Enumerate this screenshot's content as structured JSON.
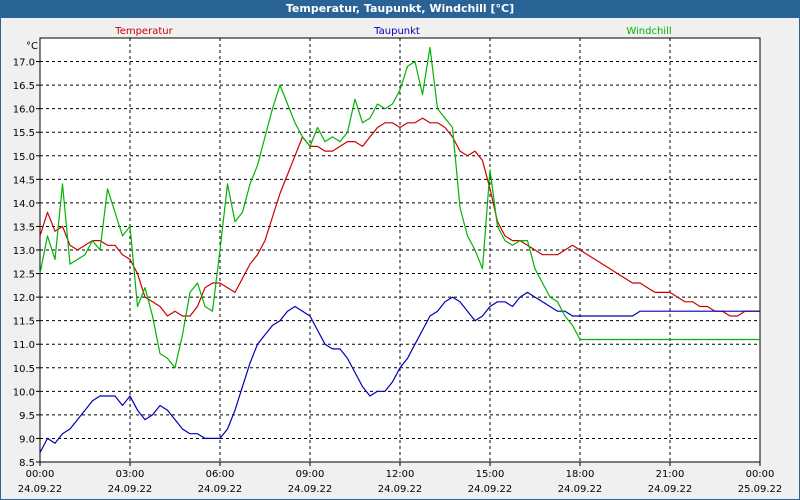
{
  "window": {
    "title": "Temperatur, Taupunkt, Windchill [°C]"
  },
  "chart_data": {
    "type": "line",
    "title": "Temperatur, Taupunkt, Windchill [°C]",
    "ylabel": "°C",
    "ylim": [
      8.5,
      17.5
    ],
    "yticks": [
      8.5,
      9.0,
      9.5,
      10.0,
      10.5,
      11.0,
      11.5,
      12.0,
      12.5,
      13.0,
      13.5,
      14.0,
      14.5,
      15.0,
      15.5,
      16.0,
      16.5,
      17.0
    ],
    "xlim": [
      "2022-09-24 00:00",
      "2022-09-25 00:00"
    ],
    "xticks": [
      {
        "time": "00:00",
        "date": "24.09.22"
      },
      {
        "time": "03:00",
        "date": "24.09.22"
      },
      {
        "time": "06:00",
        "date": "24.09.22"
      },
      {
        "time": "09:00",
        "date": "24.09.22"
      },
      {
        "time": "12:00",
        "date": "24.09.22"
      },
      {
        "time": "15:00",
        "date": "24.09.22"
      },
      {
        "time": "18:00",
        "date": "24.09.22"
      },
      {
        "time": "21:00",
        "date": "24.09.22"
      },
      {
        "time": "00:00",
        "date": "25.09.22"
      }
    ],
    "grid": true,
    "legend_position": "top",
    "x_hours": [
      0,
      0.25,
      0.5,
      0.75,
      1,
      1.25,
      1.5,
      1.75,
      2,
      2.25,
      2.5,
      2.75,
      3,
      3.25,
      3.5,
      3.75,
      4,
      4.25,
      4.5,
      4.75,
      5,
      5.25,
      5.5,
      5.75,
      6,
      6.25,
      6.5,
      6.75,
      7,
      7.25,
      7.5,
      7.75,
      8,
      8.25,
      8.5,
      8.75,
      9,
      9.25,
      9.5,
      9.75,
      10,
      10.25,
      10.5,
      10.75,
      11,
      11.25,
      11.5,
      11.75,
      12,
      12.25,
      12.5,
      12.75,
      13,
      13.25,
      13.5,
      13.75,
      14,
      14.25,
      14.5,
      14.75,
      15,
      15.25,
      15.5,
      15.75,
      16,
      16.25,
      16.5,
      16.75,
      17,
      17.25,
      17.5,
      17.75,
      18,
      18.25,
      18.5,
      18.75,
      19,
      19.25,
      19.5,
      19.75,
      20,
      20.25,
      20.5,
      20.75,
      21,
      21.25,
      21.5,
      21.75,
      22,
      22.25,
      22.5,
      22.75,
      23,
      23.25,
      23.5,
      23.75,
      24
    ],
    "series": [
      {
        "name": "Temperatur",
        "color": "#cc0000",
        "values": [
          13.3,
          13.8,
          13.4,
          13.5,
          13.1,
          13.0,
          13.1,
          13.2,
          13.2,
          13.1,
          13.1,
          12.9,
          12.8,
          12.5,
          12.0,
          11.9,
          11.8,
          11.6,
          11.7,
          11.6,
          11.6,
          11.8,
          12.2,
          12.3,
          12.3,
          12.2,
          12.1,
          12.4,
          12.7,
          12.9,
          13.2,
          13.7,
          14.2,
          14.6,
          15.0,
          15.4,
          15.2,
          15.2,
          15.1,
          15.1,
          15.2,
          15.3,
          15.3,
          15.2,
          15.4,
          15.6,
          15.7,
          15.7,
          15.6,
          15.7,
          15.7,
          15.8,
          15.7,
          15.7,
          15.6,
          15.4,
          15.1,
          15.0,
          15.1,
          14.9,
          14.3,
          13.6,
          13.3,
          13.2,
          13.2,
          13.1,
          13.0,
          12.9,
          12.9,
          12.9,
          13.0,
          13.1,
          13.0,
          12.9,
          12.8,
          12.7,
          12.6,
          12.5,
          12.4,
          12.3,
          12.3,
          12.2,
          12.1,
          12.1,
          12.1,
          12.0,
          11.9,
          11.9,
          11.8,
          11.8,
          11.7,
          11.7,
          11.6,
          11.6,
          11.7,
          11.7,
          11.7
        ]
      },
      {
        "name": "Taupunkt",
        "color": "#0000b4",
        "values": [
          8.7,
          9.0,
          8.9,
          9.1,
          9.2,
          9.4,
          9.6,
          9.8,
          9.9,
          9.9,
          9.9,
          9.7,
          9.9,
          9.6,
          9.4,
          9.5,
          9.7,
          9.6,
          9.4,
          9.2,
          9.1,
          9.1,
          9.0,
          9.0,
          9.0,
          9.2,
          9.6,
          10.1,
          10.6,
          11.0,
          11.2,
          11.4,
          11.5,
          11.7,
          11.8,
          11.7,
          11.6,
          11.3,
          11.0,
          10.9,
          10.9,
          10.7,
          10.4,
          10.1,
          9.9,
          10.0,
          10.0,
          10.2,
          10.5,
          10.7,
          11.0,
          11.3,
          11.6,
          11.7,
          11.9,
          12.0,
          11.9,
          11.7,
          11.5,
          11.6,
          11.8,
          11.9,
          11.9,
          11.8,
          12.0,
          12.1,
          12.0,
          11.9,
          11.8,
          11.7,
          11.7,
          11.6,
          11.6,
          11.6,
          11.6,
          11.6,
          11.6,
          11.6,
          11.6,
          11.6,
          11.7,
          11.7,
          11.7,
          11.7,
          11.7,
          11.7,
          11.7,
          11.7,
          11.7,
          11.7,
          11.7,
          11.7,
          11.7,
          11.7,
          11.7,
          11.7,
          11.7
        ]
      },
      {
        "name": "Windchill",
        "color": "#00b400",
        "values": [
          12.5,
          13.3,
          12.8,
          14.4,
          12.7,
          12.8,
          12.9,
          13.2,
          13.0,
          14.3,
          13.8,
          13.3,
          13.5,
          11.8,
          12.2,
          11.6,
          10.8,
          10.7,
          10.5,
          11.2,
          12.1,
          12.3,
          11.8,
          11.7,
          13.0,
          14.4,
          13.6,
          13.8,
          14.4,
          14.8,
          15.4,
          16.0,
          16.5,
          16.1,
          15.7,
          15.4,
          15.2,
          15.6,
          15.3,
          15.4,
          15.3,
          15.5,
          16.2,
          15.7,
          15.8,
          16.1,
          16.0,
          16.1,
          16.4,
          16.9,
          17.0,
          16.3,
          17.3,
          16.0,
          15.8,
          15.6,
          13.9,
          13.3,
          13.0,
          12.6,
          14.7,
          13.5,
          13.2,
          13.1,
          13.2,
          13.2,
          12.6,
          12.3,
          12.0,
          11.9,
          11.6,
          11.4,
          11.1,
          11.1,
          11.1,
          11.1,
          11.1,
          11.1,
          11.1,
          11.1,
          11.1,
          11.1,
          11.1,
          11.1,
          11.1,
          11.1,
          11.1,
          11.1,
          11.1,
          11.1,
          11.1,
          11.1,
          11.1,
          11.1,
          11.1,
          11.1,
          11.1
        ]
      }
    ]
  }
}
